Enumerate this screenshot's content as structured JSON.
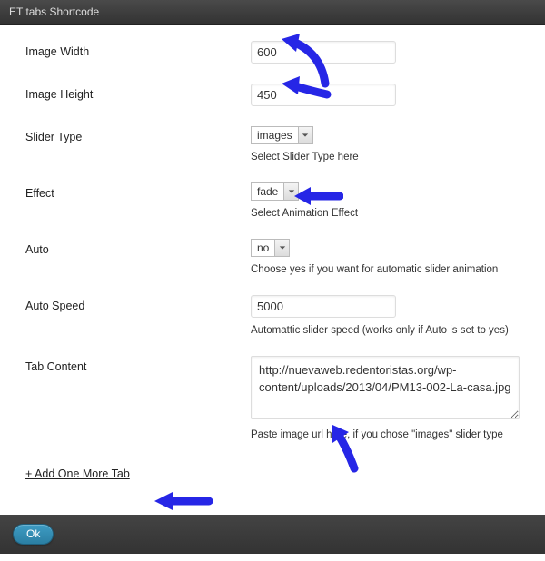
{
  "title": "ET tabs Shortcode",
  "fields": {
    "image_width": {
      "label": "Image Width",
      "value": "600"
    },
    "image_height": {
      "label": "Image Height",
      "value": "450"
    },
    "slider_type": {
      "label": "Slider Type",
      "value": "images",
      "hint": "Select Slider Type here"
    },
    "effect": {
      "label": "Effect",
      "value": "fade",
      "hint": "Select Animation Effect"
    },
    "auto": {
      "label": "Auto",
      "value": "no",
      "hint": "Choose yes if you want for automatic slider animation"
    },
    "auto_speed": {
      "label": "Auto Speed",
      "value": "5000",
      "hint": "Automattic slider speed (works only if Auto is set to yes)"
    },
    "tab_content": {
      "label": "Tab Content",
      "value": "http://nuevaweb.redentoristas.org/wp-content/uploads/2013/04/PM13-002-La-casa.jpg",
      "hint": "Paste image url here, if you chose \"images\" slider type"
    }
  },
  "add_link": "+ Add One More Tab",
  "ok_label": "Ok"
}
